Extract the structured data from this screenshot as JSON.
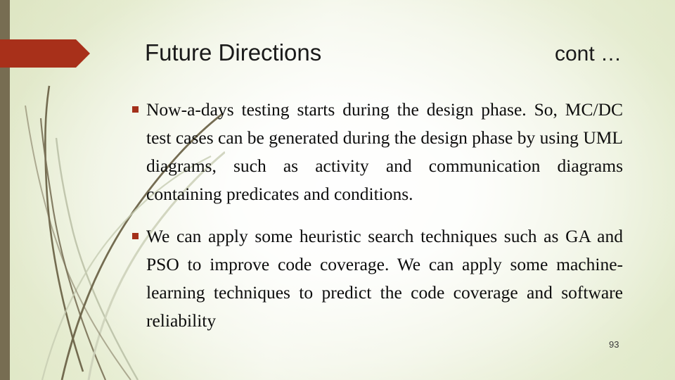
{
  "slide": {
    "title": "Future Directions",
    "title_suffix": "cont …",
    "page_number": "93",
    "colors": {
      "background_edge": "#dfe8c6",
      "background_center": "#fdfdfa",
      "left_bar": "#776d52",
      "arrow": "#a8301a",
      "bullet_marker": "#a3301a",
      "grass_dark": "#6d6449",
      "grass_light": "#cdd2ba",
      "text": "#0d0d0d"
    },
    "bullets": [
      {
        "marker": "square-bullet",
        "text": "Now-a-days testing starts during the design phase. So, MC/DC test cases can be generated during the design phase by using UML diagrams, such as activity and communication diagrams  containing predicates and conditions."
      },
      {
        "marker": "square-bullet",
        "text": "We can apply some heuristic search techniques such as GA and PSO to improve code coverage. We can apply some machine-learning techniques to predict the code coverage and software reliability"
      }
    ]
  }
}
